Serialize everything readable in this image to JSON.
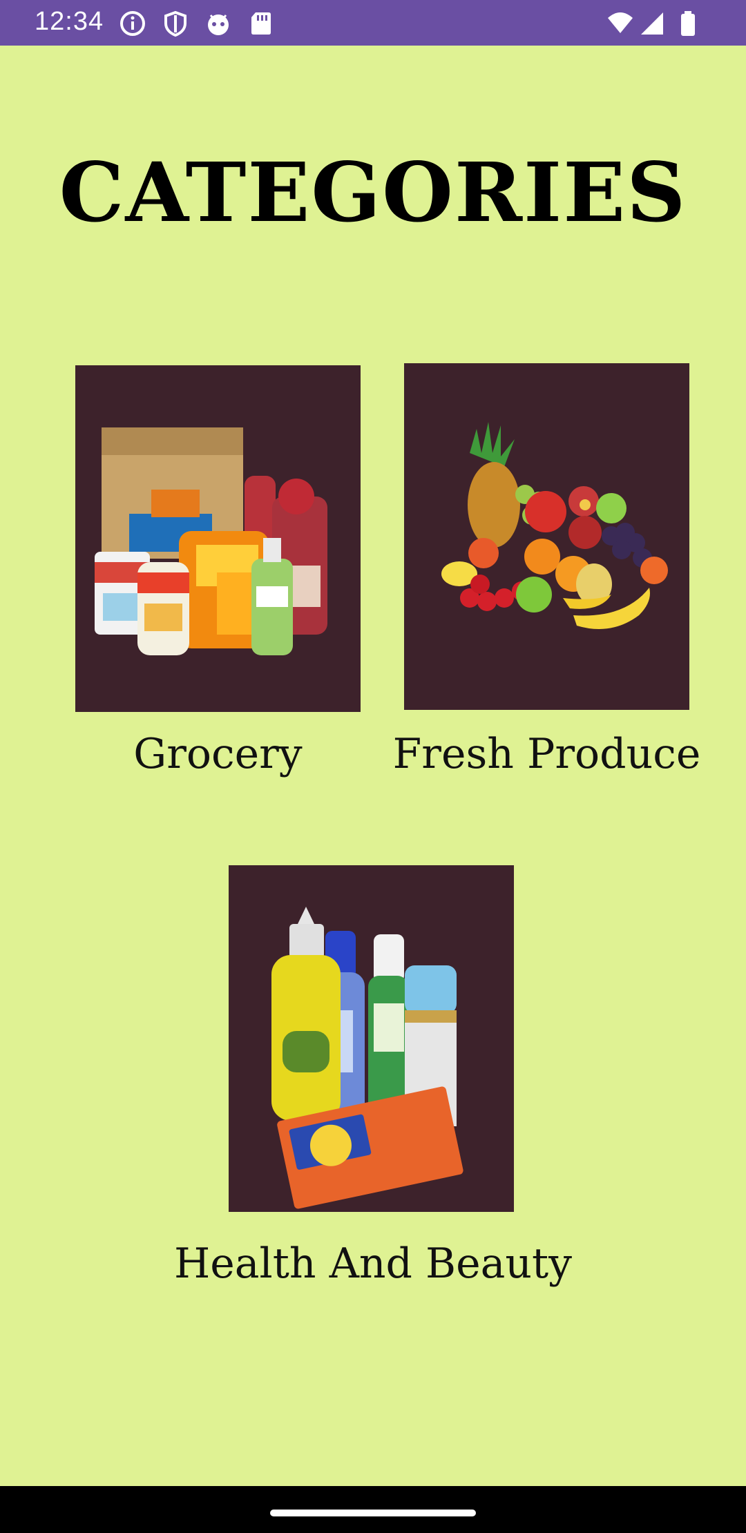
{
  "status_bar": {
    "time": "12:34",
    "icons": [
      "info-icon",
      "shield-icon",
      "android-icon",
      "sd-card-icon",
      "wifi-icon",
      "signal-icon",
      "battery-icon"
    ]
  },
  "page": {
    "title": "CATEGORIES"
  },
  "categories": [
    {
      "label": "Grocery",
      "icon": "grocery-products-image"
    },
    {
      "label": "Fresh Produce",
      "icon": "fruit-basket-image"
    },
    {
      "label": "Health And Beauty",
      "icon": "health-beauty-products-image"
    }
  ],
  "colors": {
    "background": "#dff293",
    "status_bar": "#6a4fa3",
    "card": "#3d222b",
    "nav_bar": "#000000"
  }
}
